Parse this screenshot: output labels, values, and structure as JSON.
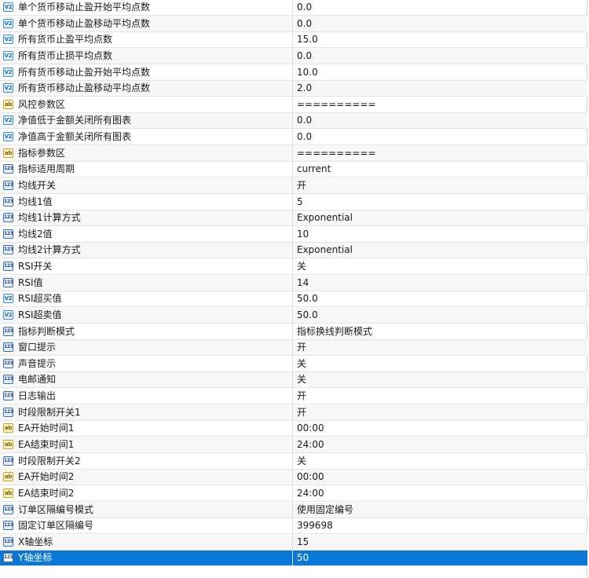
{
  "icons": {
    "v2": "V2",
    "ab": "ab",
    "123": "123"
  },
  "rows": [
    {
      "icon": "v2",
      "name": "单个货币移动止盈开始平均点数",
      "value": "0.0"
    },
    {
      "icon": "v2",
      "name": "单个货币移动止盈移动平均点数",
      "value": "0.0"
    },
    {
      "icon": "v2",
      "name": "所有货币止盈平均点数",
      "value": "15.0"
    },
    {
      "icon": "v2",
      "name": "所有货币止损平均点数",
      "value": "0.0"
    },
    {
      "icon": "v2",
      "name": "所有货币移动止盈开始平均点数",
      "value": "10.0"
    },
    {
      "icon": "v2",
      "name": "所有货币移动止盈移动平均点数",
      "value": "2.0"
    },
    {
      "icon": "ab",
      "name": "风控参数区",
      "value": "=========="
    },
    {
      "icon": "v2",
      "name": "净值低于金额关闭所有图表",
      "value": "0.0"
    },
    {
      "icon": "v2",
      "name": "净值高于金额关闭所有图表",
      "value": "0.0"
    },
    {
      "icon": "ab",
      "name": "指标参数区",
      "value": "=========="
    },
    {
      "icon": "123",
      "name": "指标适用周期",
      "value": "current"
    },
    {
      "icon": "123",
      "name": "均线开关",
      "value": "开"
    },
    {
      "icon": "123",
      "name": "均线1值",
      "value": "5"
    },
    {
      "icon": "123",
      "name": "均线1计算方式",
      "value": "Exponential"
    },
    {
      "icon": "123",
      "name": "均线2值",
      "value": "10"
    },
    {
      "icon": "123",
      "name": "均线2计算方式",
      "value": "Exponential"
    },
    {
      "icon": "123",
      "name": "RSI开关",
      "value": "关"
    },
    {
      "icon": "123",
      "name": "RSI值",
      "value": "14"
    },
    {
      "icon": "v2",
      "name": "RSI超买值",
      "value": "50.0"
    },
    {
      "icon": "v2",
      "name": "RSI超卖值",
      "value": "50.0"
    },
    {
      "icon": "123",
      "name": "指标判断模式",
      "value": "指标换线判断模式"
    },
    {
      "icon": "123",
      "name": "窗口提示",
      "value": "开"
    },
    {
      "icon": "123",
      "name": "声音提示",
      "value": "关"
    },
    {
      "icon": "123",
      "name": "电邮通知",
      "value": "关"
    },
    {
      "icon": "123",
      "name": "日志输出",
      "value": "开"
    },
    {
      "icon": "123",
      "name": "时段限制开关1",
      "value": "开"
    },
    {
      "icon": "ab",
      "name": "EA开始时间1",
      "value": "00:00"
    },
    {
      "icon": "ab",
      "name": "EA结束时间1",
      "value": "24:00"
    },
    {
      "icon": "123",
      "name": "时段限制开关2",
      "value": "关"
    },
    {
      "icon": "ab",
      "name": "EA开始时间2",
      "value": "00:00"
    },
    {
      "icon": "ab",
      "name": "EA结束时间2",
      "value": "24:00"
    },
    {
      "icon": "123",
      "name": "订单区隔编号模式",
      "value": "使用固定编号"
    },
    {
      "icon": "123",
      "name": "固定订单区隔编号",
      "value": "399698"
    },
    {
      "icon": "123",
      "name": "X轴坐标",
      "value": "15"
    },
    {
      "icon": "123",
      "name": "Y轴坐标",
      "value": "50",
      "selected": true
    }
  ]
}
